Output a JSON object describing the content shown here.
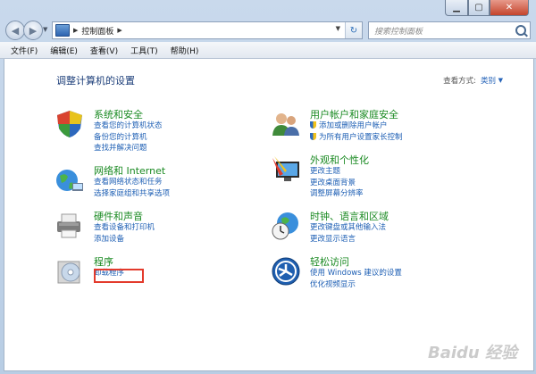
{
  "address": {
    "path": "控制面板"
  },
  "search": {
    "placeholder": "搜索控制面板"
  },
  "menu": [
    "文件(F)",
    "编辑(E)",
    "查看(V)",
    "工具(T)",
    "帮助(H)"
  ],
  "content": {
    "title": "调整计算机的设置",
    "view_by_label": "查看方式:",
    "view_by_value": "类别"
  },
  "categories": [
    {
      "heading": "系统和安全",
      "links": [
        "查看您的计算机状态",
        "备份您的计算机",
        "查找并解决问题"
      ]
    },
    {
      "heading": "网络和 Internet",
      "links": [
        "查看网络状态和任务",
        "选择家庭组和共享选项"
      ]
    },
    {
      "heading": "硬件和声音",
      "links": [
        "查看设备和打印机",
        "添加设备"
      ]
    },
    {
      "heading": "程序",
      "links": [
        "卸载程序"
      ]
    },
    {
      "heading": "用户帐户和家庭安全",
      "links": [
        "添加或删除用户帐户",
        "为所有用户设置家长控制"
      ]
    },
    {
      "heading": "外观和个性化",
      "links": [
        "更改主题",
        "更改桌面背景",
        "调整屏幕分辨率"
      ]
    },
    {
      "heading": "时钟、语言和区域",
      "links": [
        "更改键盘或其他输入法",
        "更改显示语言"
      ]
    },
    {
      "heading": "轻松访问",
      "links": [
        "使用 Windows 建议的设置",
        "优化视频显示"
      ]
    }
  ],
  "watermark": "Baidu 经验",
  "colors": {
    "heading": "#1a8a22",
    "link": "#1e5fb4",
    "highlight": "#e33a2c"
  }
}
